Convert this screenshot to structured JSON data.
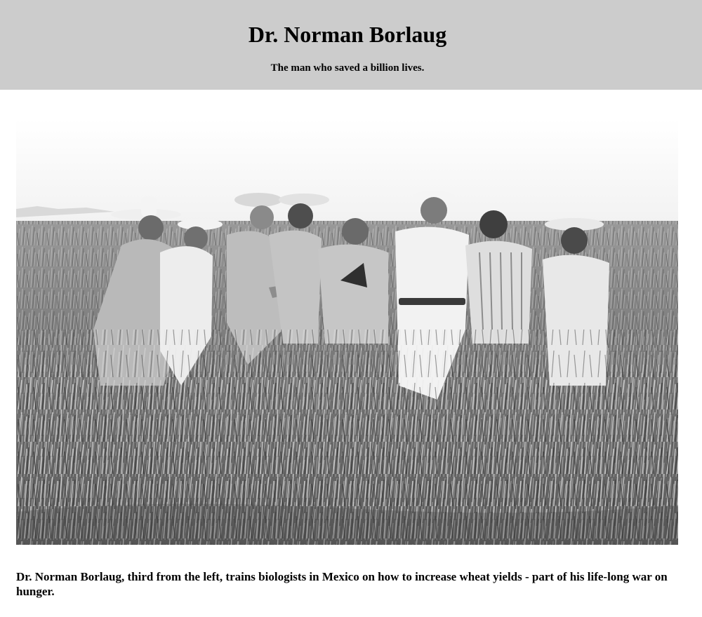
{
  "header": {
    "title": "Dr. Norman Borlaug",
    "subtitle": "The man who saved a billion lives."
  },
  "photo": {
    "alt": "Black and white photograph of Dr. Norman Borlaug with biologists standing in a wheat field in Mexico"
  },
  "caption": {
    "text": "Dr. Norman Borlaug, third from the left, trains biologists in Mexico on how to increase wheat yields - part of his life-long war on hunger."
  }
}
